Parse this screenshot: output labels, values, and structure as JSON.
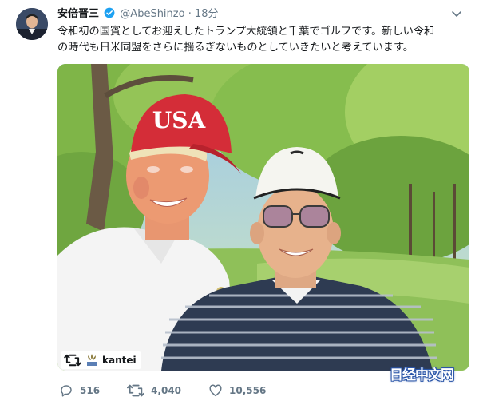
{
  "user": {
    "display_name": "安倍晋三",
    "verified": true,
    "handle": "@AbeShinzo",
    "separator": "·",
    "time": "18分"
  },
  "tweet": {
    "line1": "令和初の国賓としてお迎えしたトランプ大統領と千葉でゴルフです。新しい令和",
    "line2": "の時代も日米同盟をさらに揺るぎないものとしていきたいと考えています。"
  },
  "media": {
    "cap_text": "USA",
    "repost_account": "kantei"
  },
  "actions": {
    "replies": "516",
    "retweets": "4,040",
    "likes": "10,556"
  },
  "watermark": "日经中文网",
  "colors": {
    "verified_blue": "#1da1f2",
    "meta_gray": "#657786",
    "watermark_blue": "#2a55a8"
  },
  "icons": [
    "verified-badge-icon",
    "chevron-down-icon",
    "retweet-icon",
    "kantei-logo-icon",
    "reply-icon",
    "like-icon"
  ]
}
